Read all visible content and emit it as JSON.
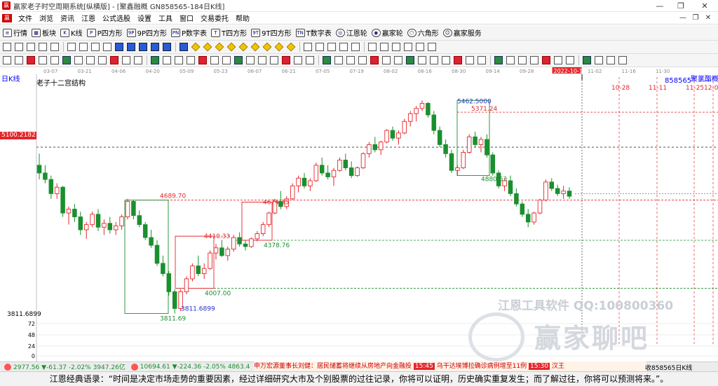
{
  "window": {
    "title": "赢家老子时空周期系统[纵横版] - [聚鑫融概  GN858565-184日K线]",
    "controls": [
      "—",
      "❐",
      "✕"
    ]
  },
  "menu": {
    "items": [
      "文件",
      "浏览",
      "资讯",
      "江恩",
      "公式选股",
      "设置",
      "工具",
      "窗口",
      "交易委托",
      "帮助"
    ]
  },
  "toolbar1": {
    "items": [
      {
        "icon": "quote-icon",
        "glyph": "≡",
        "label": "行情"
      },
      {
        "icon": "sector-icon",
        "glyph": "▦",
        "label": "板块"
      },
      {
        "icon": "kline-icon",
        "glyph": "K",
        "label": "K线"
      },
      {
        "icon": "p-square-icon",
        "glyph": "P",
        "label": "P四方形"
      },
      {
        "icon": "9p-square-icon",
        "glyph": "9P",
        "label": "9P四方形"
      },
      {
        "icon": "pn-table-icon",
        "glyph": "PN",
        "label": "P数字表"
      },
      {
        "icon": "t-square-icon",
        "glyph": "T",
        "label": "T四方形"
      },
      {
        "icon": "9t-square-icon",
        "glyph": "9T",
        "label": "9T四方形"
      },
      {
        "icon": "tn-table-icon",
        "glyph": "TN",
        "label": "T数字表"
      },
      {
        "icon": "gann-wheel-icon",
        "glyph": "◎",
        "label": "江恩轮"
      },
      {
        "icon": "winner-wheel-icon",
        "glyph": "◉",
        "label": "赢家轮"
      },
      {
        "icon": "hexagon-icon",
        "glyph": "⬡",
        "label": "六角形"
      },
      {
        "icon": "service-icon",
        "glyph": "☺",
        "label": "赢家服务"
      }
    ]
  },
  "toolbar2_icons": [
    "draw-icon",
    "cycle-icon",
    "chart-icon",
    "grid-icon",
    "line-icon",
    "candle-icon",
    "bar-icon",
    "number-icon",
    "flag-icon",
    "first-icon",
    "prev-icon",
    "next-icon",
    "last-icon",
    "play-icon",
    "stop-icon",
    "diamond-1-icon",
    "diamond-2-icon",
    "diamond-3-icon",
    "diamond-4-icon",
    "diamond-5-icon",
    "diamond-6-icon",
    "diamond-7-icon",
    "diamond-8-icon",
    "diamond-9-icon",
    "table-icon",
    "pointer-icon",
    "crosshair-icon",
    "pan-icon",
    "hand-icon",
    "price-icon",
    "book-icon",
    "save-icon",
    "print-icon",
    "copy-icon",
    "camera-icon"
  ],
  "toolbar3_icons": [
    "t1-icon",
    "t2-icon",
    "t3-icon",
    "t4-icon",
    "t5-icon",
    "t6-icon",
    "t7-icon",
    "t8-icon",
    "t9-icon",
    "t10-icon",
    "t11-icon",
    "t12-icon",
    "t13-icon",
    "t14-icon",
    "t15-icon",
    "t16-icon",
    "t17-icon",
    "t18-icon",
    "t19-icon",
    "t20-icon",
    "t21-icon",
    "t22-icon",
    "t23-icon",
    "t24-icon",
    "t25-icon",
    "t26-icon",
    "t27-icon",
    "t28-icon",
    "t29-icon",
    "t30-icon",
    "t31-icon",
    "t32-icon",
    "t33-icon",
    "t34-icon",
    "t35-icon",
    "t36-icon",
    "t37-icon",
    "t38-icon",
    "t39-icon",
    "t40-icon",
    "t41-icon",
    "t42-icon",
    "t43-icon",
    "t44-icon",
    "t45-icon",
    "t46-icon",
    "t47-icon",
    "t48-icon",
    "t49-icon",
    "t50-icon",
    "t51-icon"
  ],
  "chart": {
    "period": "日K线",
    "title": "老子十二宫结构",
    "code": "858565",
    "name": "聚氯酯概",
    "current_price_tag": "5100.2182",
    "low_axis_label": "3811.6899",
    "date_ticks": [
      "03-07",
      "03-21",
      "04-06",
      "04-20",
      "05-09",
      "05-23",
      "06-07",
      "06-21",
      "07-05",
      "07-19",
      "08-02",
      "08-16",
      "08-30",
      "09-14",
      "09-28",
      "2022-10-14",
      "11-02",
      "11-16",
      "11-30"
    ],
    "future_dates": [
      "10-28",
      "11-11",
      "11-25",
      "12-0"
    ],
    "volume_ticks": [
      "72",
      "48",
      "24",
      "0"
    ],
    "level_labels": [
      "5462.5000",
      "5371.24",
      "4880.63",
      "4689.70",
      "4674.35",
      "4410.33",
      "4378.76",
      "4007.00",
      "3811.6899",
      "3811.69"
    ]
  },
  "chart_data": {
    "type": "candlestick",
    "title": "老子十二宫结构",
    "x_ticks": [
      "03-07",
      "03-21",
      "04-06",
      "04-20",
      "05-09",
      "05-23",
      "06-07",
      "06-21",
      "07-05",
      "07-19",
      "08-02",
      "08-16",
      "08-30",
      "09-14",
      "09-28",
      "2022-10-14",
      "11-02",
      "11-16",
      "11-30"
    ],
    "y_range": [
      3700,
      5600
    ],
    "annotated_levels": [
      5462.5,
      5371.24,
      5100.2182,
      4880.63,
      4689.7,
      4674.35,
      4410.33,
      4378.76,
      4007.0,
      3811.6899
    ],
    "high": 5462.5,
    "low": 3811.6899,
    "ohlc": [
      [
        4960,
        5050,
        4850,
        4900
      ],
      [
        4900,
        4960,
        4820,
        4850
      ],
      [
        4850,
        4880,
        4700,
        4740
      ],
      [
        4740,
        4820,
        4700,
        4790
      ],
      [
        4790,
        4800,
        4560,
        4590
      ],
      [
        4590,
        4640,
        4500,
        4620
      ],
      [
        4620,
        4660,
        4520,
        4560
      ],
      [
        4560,
        4600,
        4420,
        4460
      ],
      [
        4460,
        4520,
        4390,
        4500
      ],
      [
        4500,
        4600,
        4480,
        4580
      ],
      [
        4580,
        4620,
        4450,
        4480
      ],
      [
        4480,
        4540,
        4420,
        4510
      ],
      [
        4510,
        4560,
        4430,
        4460
      ],
      [
        4460,
        4520,
        4420,
        4490
      ],
      [
        4490,
        4580,
        4460,
        4560
      ],
      [
        4560,
        4700,
        4540,
        4680
      ],
      [
        4680,
        4690,
        4540,
        4570
      ],
      [
        4570,
        4610,
        4480,
        4500
      ],
      [
        4500,
        4520,
        4380,
        4400
      ],
      [
        4400,
        4460,
        4320,
        4340
      ],
      [
        4340,
        4380,
        4180,
        4200
      ],
      [
        4200,
        4260,
        4100,
        4120
      ],
      [
        4120,
        4140,
        3950,
        3980
      ],
      [
        3980,
        4000,
        3811,
        3850
      ],
      [
        3850,
        4000,
        3830,
        3980
      ],
      [
        3980,
        4100,
        3960,
        4080
      ],
      [
        4080,
        4200,
        4060,
        4180
      ],
      [
        4180,
        4260,
        4100,
        4120
      ],
      [
        4120,
        4200,
        4080,
        4160
      ],
      [
        4160,
        4300,
        4150,
        4280
      ],
      [
        4280,
        4350,
        4230,
        4320
      ],
      [
        4320,
        4380,
        4250,
        4260
      ],
      [
        4260,
        4330,
        4220,
        4310
      ],
      [
        4310,
        4420,
        4290,
        4400
      ],
      [
        4400,
        4440,
        4330,
        4350
      ],
      [
        4350,
        4380,
        4300,
        4330
      ],
      [
        4330,
        4400,
        4320,
        4390
      ],
      [
        4390,
        4450,
        4370,
        4430
      ],
      [
        4430,
        4520,
        4410,
        4500
      ],
      [
        4500,
        4600,
        4480,
        4590
      ],
      [
        4590,
        4700,
        4580,
        4680
      ],
      [
        4680,
        4760,
        4620,
        4640
      ],
      [
        4640,
        4720,
        4620,
        4700
      ],
      [
        4700,
        4820,
        4690,
        4800
      ],
      [
        4800,
        4880,
        4750,
        4860
      ],
      [
        4860,
        4900,
        4780,
        4800
      ],
      [
        4800,
        4860,
        4760,
        4840
      ],
      [
        4840,
        4980,
        4830,
        4960
      ],
      [
        4960,
        5020,
        4880,
        4900
      ],
      [
        4900,
        4960,
        4850,
        4870
      ],
      [
        4870,
        4940,
        4800,
        4920
      ],
      [
        4920,
        5020,
        4910,
        5000
      ],
      [
        5000,
        5050,
        4920,
        4940
      ],
      [
        4940,
        4990,
        4860,
        4880
      ],
      [
        4880,
        4950,
        4870,
        4940
      ],
      [
        4940,
        5060,
        4930,
        5050
      ],
      [
        5050,
        5140,
        5020,
        5120
      ],
      [
        5120,
        5180,
        5060,
        5080
      ],
      [
        5080,
        5150,
        5040,
        5140
      ],
      [
        5140,
        5240,
        5130,
        5230
      ],
      [
        5230,
        5260,
        5150,
        5170
      ],
      [
        5170,
        5230,
        5120,
        5210
      ],
      [
        5210,
        5320,
        5200,
        5300
      ],
      [
        5300,
        5380,
        5260,
        5360
      ],
      [
        5360,
        5420,
        5300,
        5400
      ],
      [
        5400,
        5462,
        5380,
        5440
      ],
      [
        5440,
        5450,
        5330,
        5350
      ],
      [
        5350,
        5380,
        5200,
        5230
      ],
      [
        5230,
        5260,
        5100,
        5120
      ],
      [
        5120,
        5160,
        5020,
        5050
      ],
      [
        5050,
        5080,
        4900,
        4920
      ],
      [
        4920,
        4960,
        4880,
        4940
      ],
      [
        4940,
        5080,
        4930,
        5060
      ],
      [
        5060,
        5200,
        5050,
        5180
      ],
      [
        5180,
        5220,
        5100,
        5120
      ],
      [
        5120,
        5180,
        5060,
        5160
      ],
      [
        5160,
        5200,
        5020,
        5040
      ],
      [
        5040,
        5060,
        4880,
        4900
      ],
      [
        4900,
        4920,
        4780,
        4800
      ],
      [
        4800,
        4860,
        4760,
        4840
      ],
      [
        4840,
        4880,
        4720,
        4740
      ],
      [
        4740,
        4780,
        4640,
        4660
      ],
      [
        4660,
        4680,
        4560,
        4580
      ],
      [
        4580,
        4620,
        4480,
        4520
      ],
      [
        4520,
        4600,
        4500,
        4590
      ],
      [
        4590,
        4700,
        4580,
        4690
      ],
      [
        4690,
        4850,
        4680,
        4830
      ],
      [
        4830,
        4860,
        4760,
        4780
      ],
      [
        4780,
        4810,
        4720,
        4740
      ],
      [
        4740,
        4800,
        4700,
        4760
      ],
      [
        4760,
        4790,
        4700,
        4720
      ]
    ]
  },
  "status": {
    "idx1": "2977.56 ▼-61.37 -2.02% 3947.26亿",
    "idx2": "10694.61 ▼-224.36 -2.05% 4863.4",
    "news1": "申万宏源董事长刘健：居民储蓄将继续从房地产向金融投",
    "news_time2": "15:45",
    "news2": "乌干达埃博拉确诊病例增至11例",
    "news_time3": "15:30",
    "news3": "汉王",
    "right": "收858565日K线"
  },
  "quote": "江恩经典语录：“时间是决定市场走势的重要因素，经过详细研究大市及个别股票的过往记录，你将可以证明，历史确实重复发生；而了解过往，你将可以预测将来。”。",
  "watermark": {
    "line1": "江恩工具软件  QQ:100800360",
    "line2": "赢家聊吧"
  },
  "colors": {
    "up": "#e4262b",
    "down": "#1a8f2e",
    "level_red": "#e4262b",
    "level_green": "#1a8f2e",
    "level_blue": "#2330c9",
    "price_tag": "#e4262b"
  }
}
